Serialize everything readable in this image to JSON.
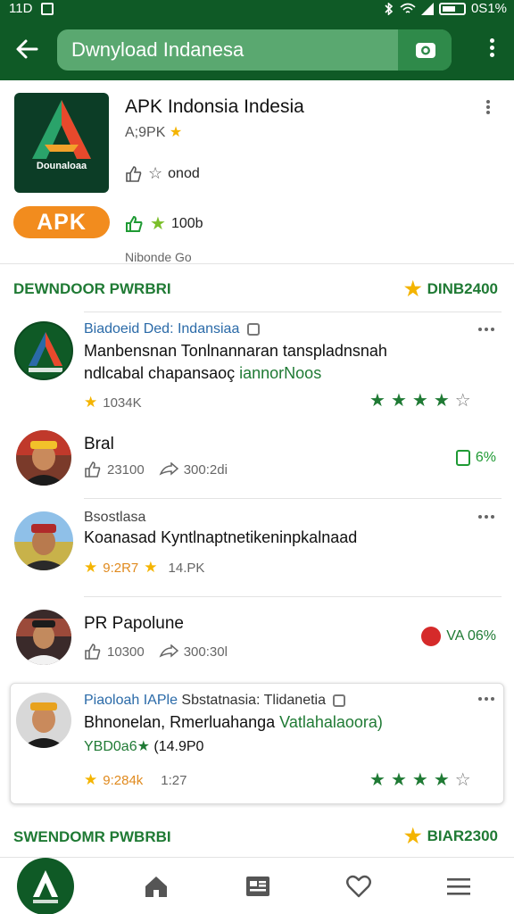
{
  "status_bar": {
    "time": "11D",
    "battery_text": "0S1%"
  },
  "search": {
    "text": "Dwnyload Indanesa"
  },
  "app": {
    "title": "APK Indonsia Indesia",
    "subtitle": "A;9PK",
    "line1": "onod",
    "line2": "100b",
    "badge": "APK",
    "icon_text": "Dounaloaa",
    "note": "Nibonde Go"
  },
  "section1": {
    "title": "DEWNDOOR PWRBRI",
    "count": "DINB2400"
  },
  "items": [
    {
      "header": "Biadoeid Ded: Indansiaa",
      "line1": "Manbensnan Tonlnannaran tanspladnsnah",
      "line2a": "ndlcabal chapansaoç ",
      "line2b": "iannorNoos",
      "stat": "1034K",
      "rating": 4
    },
    {
      "name": "Bral",
      "stat1": "23100",
      "stat2": "300:2di",
      "badge": "6%"
    },
    {
      "header": "Bsostlasa",
      "line1": "Koanasad Kyntlnaptnetikeninpkalnaad",
      "stat1": "9:2R7",
      "stat2": "14.PK"
    },
    {
      "name": "PR Papolune",
      "stat1": "10300",
      "stat2": "300:30l",
      "badge": "VA 06%"
    },
    {
      "header_a": "Piaoloah IAPle",
      "header_b": " Sbstatnasia: Tlidanetia",
      "line1a": "Bhnonelan, Rmerluahanga ",
      "line1b": "Vatlahalaoora)",
      "line2a": "YBD0a6",
      "line2b": " (14.9P0",
      "stat1": "9:284k",
      "stat2": "1:27",
      "rating": 4
    }
  ],
  "section2": {
    "title": "SWENDOMR PWBRBI",
    "count": "BIAR2300"
  },
  "colors": {
    "brand": "#0f5a26",
    "accent": "#1f7a34",
    "apk_orange": "#f28c1e",
    "star": "#f4b400"
  }
}
